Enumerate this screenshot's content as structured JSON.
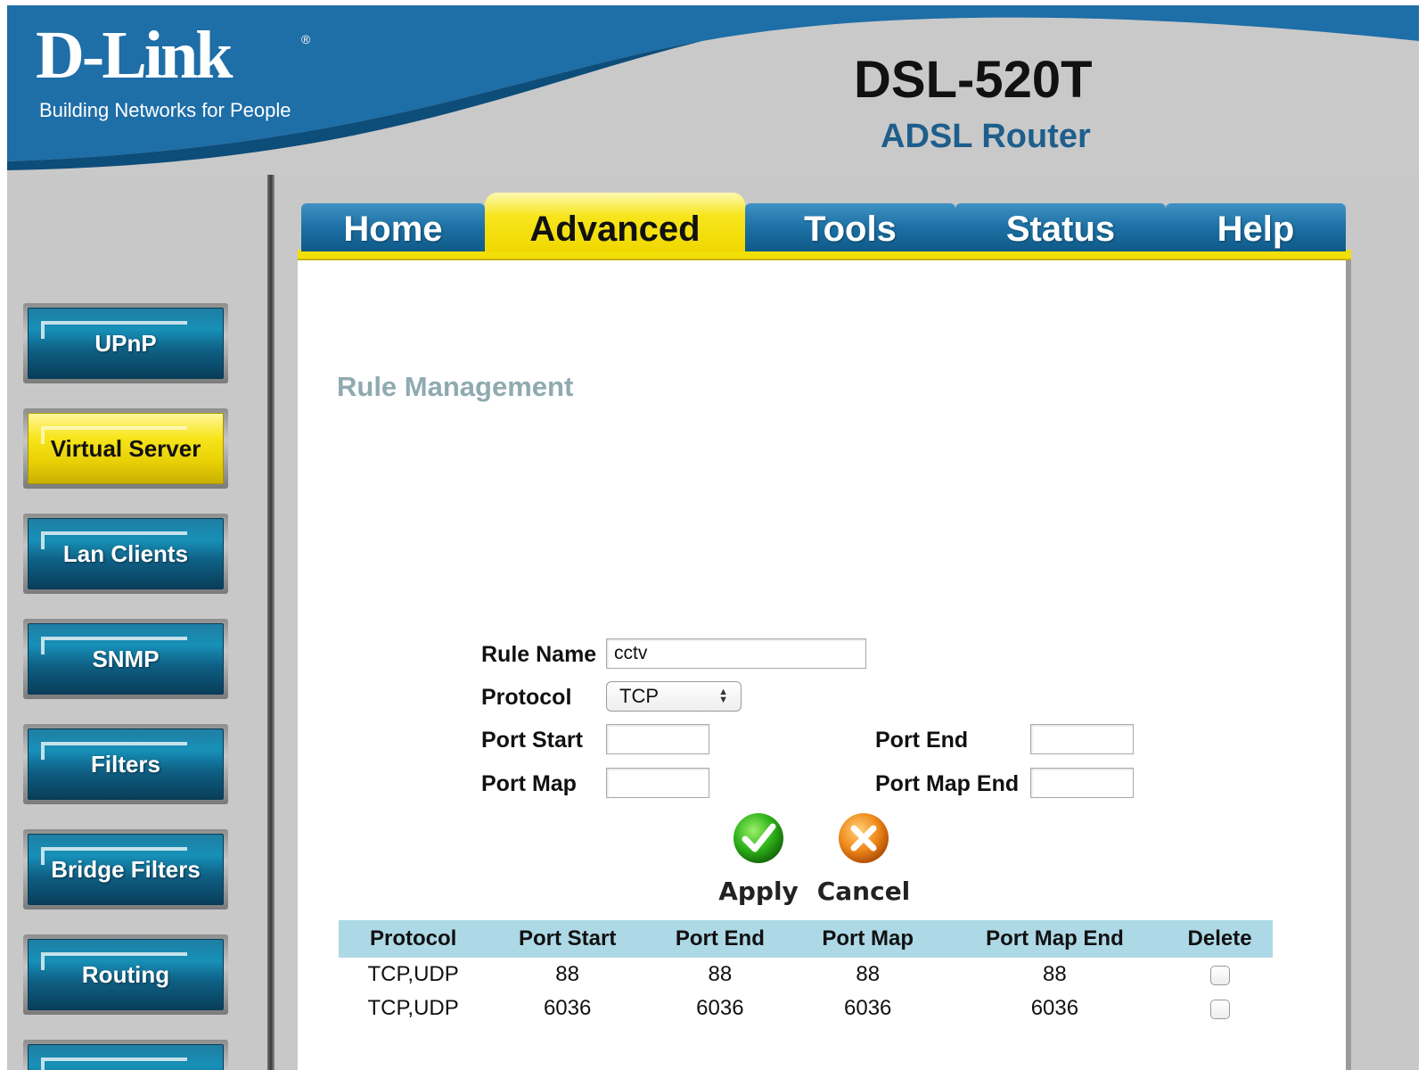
{
  "header": {
    "logo": "D-Link",
    "logo_mark": "®",
    "tagline": "Building Networks for People",
    "model": "DSL-520T",
    "model_subtitle": "ADSL Router"
  },
  "tabs": [
    {
      "label": "Home",
      "active": false
    },
    {
      "label": "Advanced",
      "active": true
    },
    {
      "label": "Tools",
      "active": false
    },
    {
      "label": "Status",
      "active": false
    },
    {
      "label": "Help",
      "active": false
    }
  ],
  "sidebar": {
    "items": [
      {
        "label": "UPnP",
        "active": false
      },
      {
        "label": "Virtual Server",
        "active": true
      },
      {
        "label": "Lan Clients",
        "active": false
      },
      {
        "label": "SNMP",
        "active": false
      },
      {
        "label": "Filters",
        "active": false
      },
      {
        "label": "Bridge Filters",
        "active": false
      },
      {
        "label": "Routing",
        "active": false
      }
    ]
  },
  "main": {
    "title": "Rule Management",
    "form": {
      "rule_name_label": "Rule Name",
      "rule_name_value": "cctv",
      "protocol_label": "Protocol",
      "protocol_value": "TCP",
      "port_start_label": "Port Start",
      "port_start_value": "",
      "port_end_label": "Port End",
      "port_end_value": "",
      "port_map_label": "Port Map",
      "port_map_value": "",
      "port_map_end_label": "Port Map End",
      "port_map_end_value": ""
    },
    "actions": {
      "apply_label": "Apply",
      "cancel_label": "Cancel"
    },
    "table": {
      "columns": [
        "Protocol",
        "Port Start",
        "Port End",
        "Port Map",
        "Port Map End",
        "Delete"
      ],
      "rows": [
        {
          "protocol": "TCP,UDP",
          "port_start": "88",
          "port_end": "88",
          "port_map": "88",
          "port_map_end": "88",
          "delete": false
        },
        {
          "protocol": "TCP,UDP",
          "port_start": "6036",
          "port_end": "6036",
          "port_map": "6036",
          "port_map_end": "6036",
          "delete": false
        }
      ]
    }
  },
  "colors": {
    "brand_blue": "#1e6ea7",
    "accent_yellow": "#f3df08",
    "table_header": "#add8e6",
    "title_gray": "#8faab0"
  }
}
